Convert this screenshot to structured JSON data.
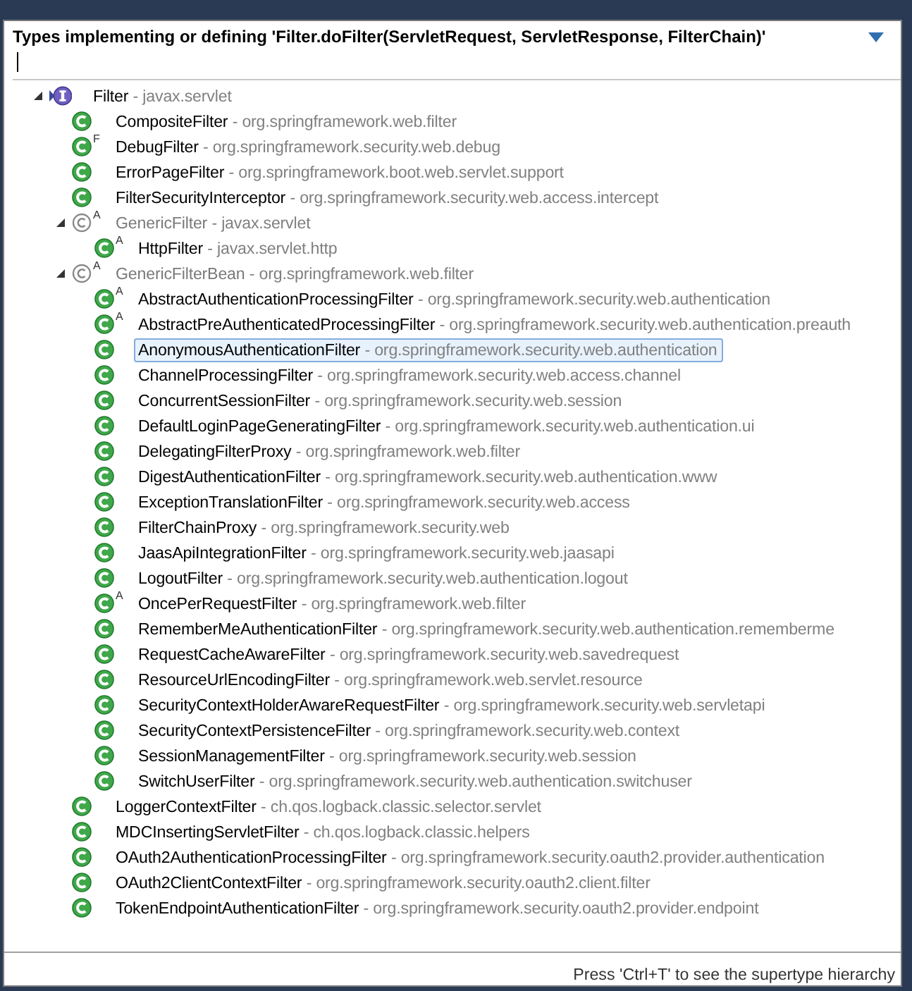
{
  "popup": {
    "title": "Types implementing or defining 'Filter.doFilter(ServletRequest, ServletResponse, FilterChain)'",
    "tree": [
      {
        "name": "Filter",
        "detail": "- javax.servlet",
        "kind": "interface",
        "dimmed": false,
        "selected": false,
        "expanded": true,
        "children": [
          {
            "name": "CompositeFilter",
            "detail": "- org.springframework.web.filter",
            "kind": "class",
            "dimmed": false,
            "selected": false
          },
          {
            "name": "DebugFilter",
            "detail": "- org.springframework.security.web.debug",
            "kind": "class",
            "modifier": "F",
            "dimmed": false,
            "selected": false
          },
          {
            "name": "ErrorPageFilter",
            "detail": "- org.springframework.boot.web.servlet.support",
            "kind": "class",
            "dimmed": false,
            "selected": false
          },
          {
            "name": "FilterSecurityInterceptor",
            "detail": "- org.springframework.security.web.access.intercept",
            "kind": "class",
            "dimmed": false,
            "selected": false
          },
          {
            "name": "GenericFilter",
            "detail": "- javax.servlet",
            "kind": "outline",
            "modifier": "A",
            "dimmed": true,
            "selected": false,
            "expanded": true,
            "children": [
              {
                "name": "HttpFilter",
                "detail": "- javax.servlet.http",
                "kind": "class",
                "modifier": "A",
                "dimmed": false,
                "selected": false
              }
            ]
          },
          {
            "name": "GenericFilterBean",
            "detail": "- org.springframework.web.filter",
            "kind": "outline",
            "modifier": "A",
            "dimmed": true,
            "selected": false,
            "expanded": true,
            "children": [
              {
                "name": "AbstractAuthenticationProcessingFilter",
                "detail": "- org.springframework.security.web.authentication",
                "kind": "class",
                "modifier": "A",
                "dimmed": false,
                "selected": false
              },
              {
                "name": "AbstractPreAuthenticatedProcessingFilter",
                "detail": "- org.springframework.security.web.authentication.preauth",
                "kind": "class",
                "modifier": "A",
                "dimmed": false,
                "selected": false
              },
              {
                "name": "AnonymousAuthenticationFilter",
                "detail": "- org.springframework.security.web.authentication",
                "kind": "class",
                "dimmed": false,
                "selected": true
              },
              {
                "name": "ChannelProcessingFilter",
                "detail": "- org.springframework.security.web.access.channel",
                "kind": "class",
                "dimmed": false,
                "selected": false
              },
              {
                "name": "ConcurrentSessionFilter",
                "detail": "- org.springframework.security.web.session",
                "kind": "class",
                "dimmed": false,
                "selected": false
              },
              {
                "name": "DefaultLoginPageGeneratingFilter",
                "detail": "- org.springframework.security.web.authentication.ui",
                "kind": "class",
                "dimmed": false,
                "selected": false
              },
              {
                "name": "DelegatingFilterProxy",
                "detail": "- org.springframework.web.filter",
                "kind": "class",
                "dimmed": false,
                "selected": false
              },
              {
                "name": "DigestAuthenticationFilter",
                "detail": "- org.springframework.security.web.authentication.www",
                "kind": "class",
                "dimmed": false,
                "selected": false
              },
              {
                "name": "ExceptionTranslationFilter",
                "detail": "- org.springframework.security.web.access",
                "kind": "class",
                "dimmed": false,
                "selected": false
              },
              {
                "name": "FilterChainProxy",
                "detail": "- org.springframework.security.web",
                "kind": "class",
                "dimmed": false,
                "selected": false
              },
              {
                "name": "JaasApiIntegrationFilter",
                "detail": "- org.springframework.security.web.jaasapi",
                "kind": "class",
                "dimmed": false,
                "selected": false
              },
              {
                "name": "LogoutFilter",
                "detail": "- org.springframework.security.web.authentication.logout",
                "kind": "class",
                "dimmed": false,
                "selected": false
              },
              {
                "name": "OncePerRequestFilter",
                "detail": "- org.springframework.web.filter",
                "kind": "class",
                "modifier": "A",
                "dimmed": false,
                "selected": false
              },
              {
                "name": "RememberMeAuthenticationFilter",
                "detail": "- org.springframework.security.web.authentication.rememberme",
                "kind": "class",
                "dimmed": false,
                "selected": false
              },
              {
                "name": "RequestCacheAwareFilter",
                "detail": "- org.springframework.security.web.savedrequest",
                "kind": "class",
                "dimmed": false,
                "selected": false
              },
              {
                "name": "ResourceUrlEncodingFilter",
                "detail": "- org.springframework.web.servlet.resource",
                "kind": "class",
                "dimmed": false,
                "selected": false
              },
              {
                "name": "SecurityContextHolderAwareRequestFilter",
                "detail": "- org.springframework.security.web.servletapi",
                "kind": "class",
                "dimmed": false,
                "selected": false
              },
              {
                "name": "SecurityContextPersistenceFilter",
                "detail": "- org.springframework.security.web.context",
                "kind": "class",
                "dimmed": false,
                "selected": false
              },
              {
                "name": "SessionManagementFilter",
                "detail": "- org.springframework.security.web.session",
                "kind": "class",
                "dimmed": false,
                "selected": false
              },
              {
                "name": "SwitchUserFilter",
                "detail": "- org.springframework.security.web.authentication.switchuser",
                "kind": "class",
                "dimmed": false,
                "selected": false
              }
            ]
          },
          {
            "name": "LoggerContextFilter",
            "detail": "- ch.qos.logback.classic.selector.servlet",
            "kind": "class",
            "dimmed": false,
            "selected": false
          },
          {
            "name": "MDCInsertingServletFilter",
            "detail": "- ch.qos.logback.classic.helpers",
            "kind": "class",
            "dimmed": false,
            "selected": false
          },
          {
            "name": "OAuth2AuthenticationProcessingFilter",
            "detail": "- org.springframework.security.oauth2.provider.authentication",
            "kind": "class",
            "dimmed": false,
            "selected": false
          },
          {
            "name": "OAuth2ClientContextFilter",
            "detail": "- org.springframework.security.oauth2.client.filter",
            "kind": "class",
            "dimmed": false,
            "selected": false
          },
          {
            "name": "TokenEndpointAuthenticationFilter",
            "detail": "- org.springframework.security.oauth2.provider.endpoint",
            "kind": "class",
            "dimmed": false,
            "selected": false
          }
        ]
      }
    ],
    "status_hint": "Press 'Ctrl+T' to see the supertype hierarchy"
  }
}
